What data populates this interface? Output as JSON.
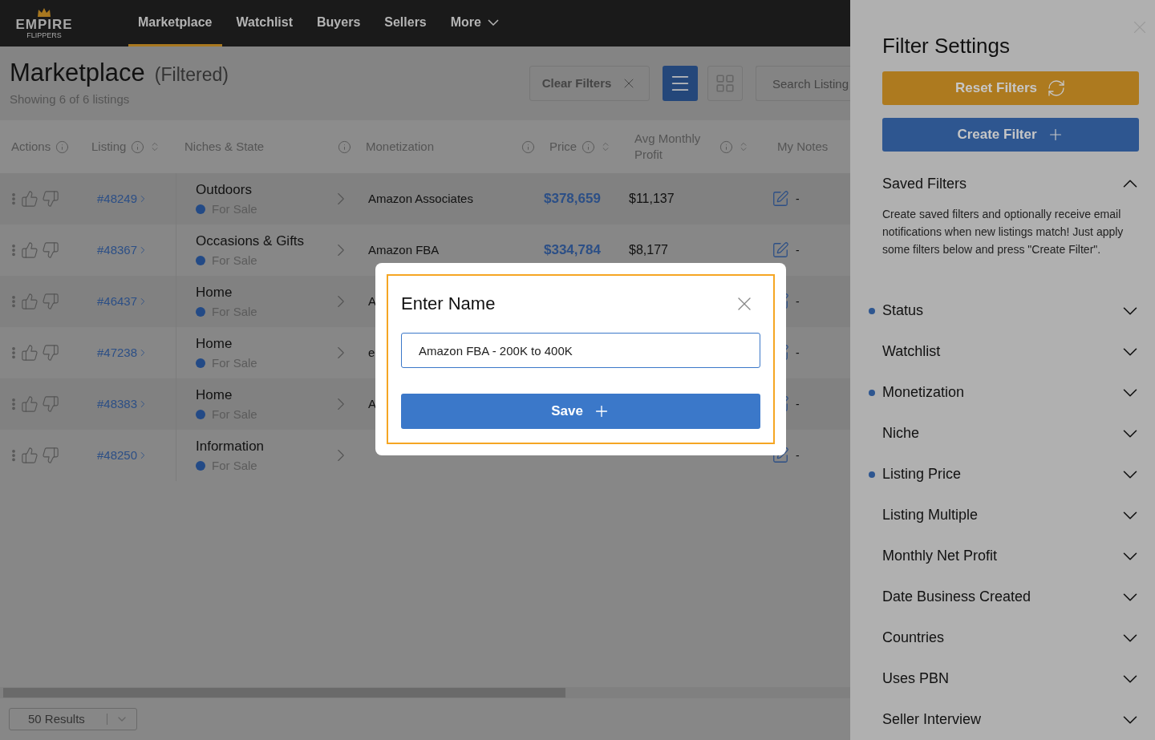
{
  "nav": {
    "logo": {
      "name": "EMPIRE",
      "tagline": "FLIPPERS"
    },
    "items": [
      {
        "label": "Marketplace",
        "selected": true,
        "dropdown": false
      },
      {
        "label": "Watchlist",
        "selected": false,
        "dropdown": false
      },
      {
        "label": "Buyers",
        "selected": false,
        "dropdown": false
      },
      {
        "label": "Sellers",
        "selected": false,
        "dropdown": false
      },
      {
        "label": "More",
        "selected": false,
        "dropdown": true
      }
    ]
  },
  "header": {
    "title": "Marketplace",
    "qualifier": "(Filtered)",
    "subtitle": "Showing 6 of 6 listings",
    "clear_button": "Clear Filters",
    "view_buttons": [
      {
        "kind": "list",
        "selected": true
      },
      {
        "kind": "grid",
        "selected": false
      }
    ],
    "search": {
      "placeholder": "Search Listing"
    }
  },
  "table": {
    "columns": [
      {
        "label": "Actions",
        "info": true,
        "sort": false
      },
      {
        "label": "Listing",
        "info": true,
        "sort": true
      },
      {
        "label": "Niches & State",
        "info": true,
        "sort": false
      },
      {
        "label": "Monetization",
        "info": true,
        "sort": false
      },
      {
        "label": "Price",
        "info": true,
        "sort": true
      },
      {
        "label": "Avg Monthly Profit",
        "info": true,
        "sort": true
      },
      {
        "label": "My Notes",
        "info": false,
        "sort": false
      }
    ],
    "rows": [
      {
        "listing": "#48249",
        "niche": "Outdoors",
        "state": "For Sale",
        "monetization": "Amazon Associates",
        "price": "$378,659",
        "profit": "$11,137",
        "notes": "-"
      },
      {
        "listing": "#48367",
        "niche": "Occasions & Gifts",
        "state": "For Sale",
        "monetization": "Amazon FBA",
        "price": "$334,784",
        "profit": "$8,177",
        "notes": "-"
      },
      {
        "listing": "#46437",
        "niche": "Home",
        "state": "For Sale",
        "monetization": "A",
        "notes": "-"
      },
      {
        "listing": "#47238",
        "niche": "Home",
        "state": "For Sale",
        "monetization": "e",
        "notes": "-"
      },
      {
        "listing": "#48383",
        "niche": "Home",
        "state": "For Sale",
        "monetization": "A",
        "notes": "-"
      },
      {
        "listing": "#48250",
        "niche": "Information",
        "state": "For Sale",
        "notes": "-"
      }
    ]
  },
  "footer": {
    "results": "50 Results"
  },
  "modal": {
    "title": "Enter Name",
    "value": "Amazon FBA - 200K to 400K",
    "button": "Save"
  },
  "sidebar": {
    "title": "Filter Settings",
    "reset_button": "Reset Filters",
    "create_button": "Create Filter",
    "saved": {
      "title": "Saved Filters",
      "expanded": true,
      "description": "Create saved filters and optionally receive email notifications when new listings match! Just apply some filters below and press \"Create Filter\"."
    },
    "filters": [
      {
        "label": "Status",
        "active": true
      },
      {
        "label": "Watchlist",
        "active": false
      },
      {
        "label": "Monetization",
        "active": true
      },
      {
        "label": "Niche",
        "active": false
      },
      {
        "label": "Listing Price",
        "active": true
      },
      {
        "label": "Listing Multiple",
        "active": false
      },
      {
        "label": "Monthly Net Profit",
        "active": false
      },
      {
        "label": "Date Business Created",
        "active": false
      },
      {
        "label": "Countries",
        "active": false
      },
      {
        "label": "Uses PBN",
        "active": false
      },
      {
        "label": "Seller Interview",
        "active": false
      }
    ]
  }
}
